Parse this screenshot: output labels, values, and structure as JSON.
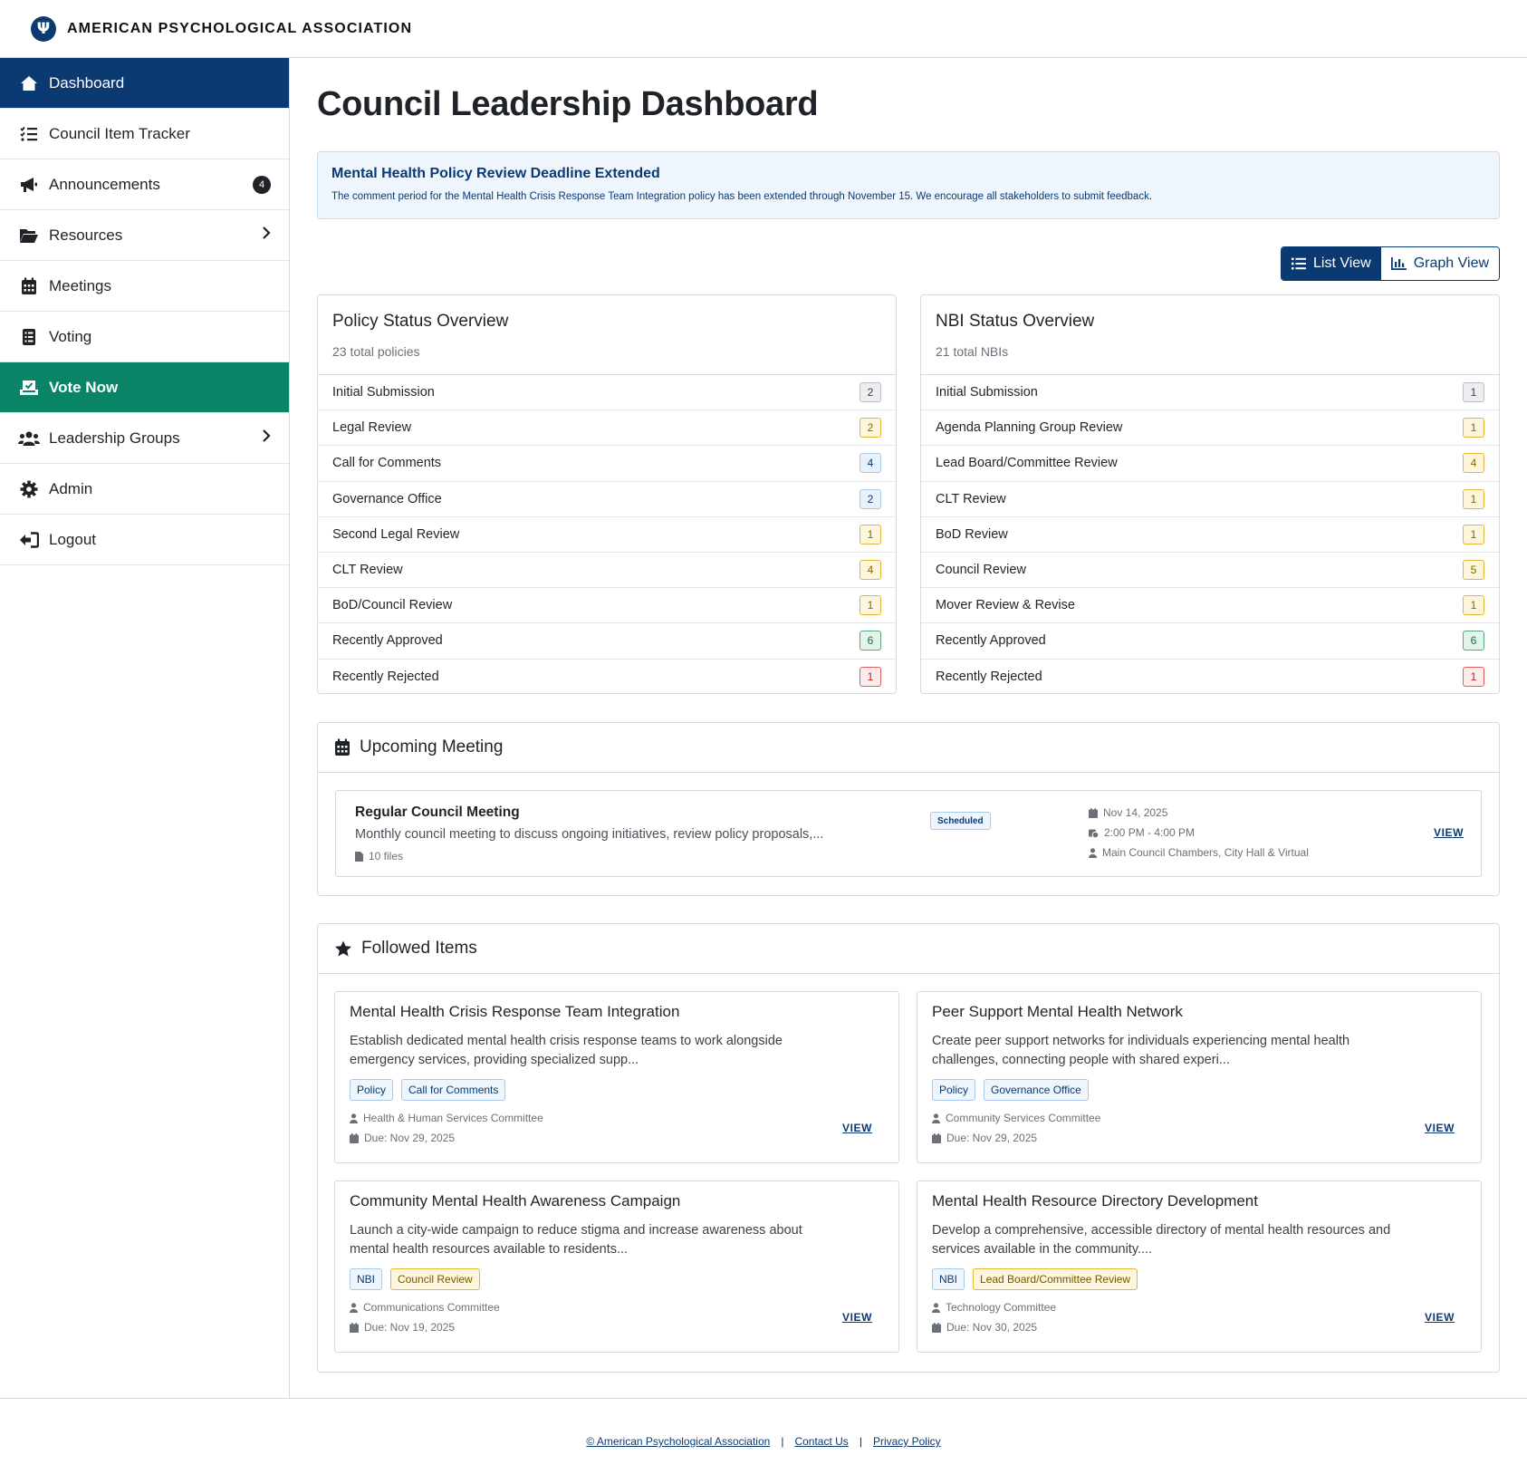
{
  "header": {
    "org_name": "AMERICAN PSYCHOLOGICAL ASSOCIATION",
    "logo_glyph": "Ψ"
  },
  "sidebar": {
    "items": [
      {
        "label": "Dashboard",
        "icon": "home-icon"
      },
      {
        "label": "Council Item Tracker",
        "icon": "list-check-icon"
      },
      {
        "label": "Announcements",
        "icon": "megaphone-icon",
        "badge": "4"
      },
      {
        "label": "Resources",
        "icon": "folder-open-icon",
        "chevron": "›"
      },
      {
        "label": "Meetings",
        "icon": "calendar-icon"
      },
      {
        "label": "Voting",
        "icon": "ballot-icon"
      },
      {
        "label": "Vote Now",
        "icon": "vote-box-icon"
      },
      {
        "label": "Leadership Groups",
        "icon": "users-icon",
        "chevron": "›"
      },
      {
        "label": "Admin",
        "icon": "gear-icon"
      },
      {
        "label": "Logout",
        "icon": "logout-icon"
      }
    ]
  },
  "page": {
    "title": "Council Leadership Dashboard"
  },
  "alert": {
    "title": "Mental Health Policy Review Deadline Extended",
    "body": "The comment period for the Mental Health Crisis Response Team Integration policy has been extended through November 15. We encourage all stakeholders to submit feedback."
  },
  "view_toggle": {
    "list_label": "List View",
    "graph_label": "Graph View"
  },
  "policy_panel": {
    "title": "Policy Status Overview",
    "subtitle": "23 total policies",
    "rows": [
      {
        "label": "Initial Submission",
        "count": "2",
        "color": "gray"
      },
      {
        "label": "Legal Review",
        "count": "2",
        "color": "yellow"
      },
      {
        "label": "Call for Comments",
        "count": "4",
        "color": "blue"
      },
      {
        "label": "Governance Office",
        "count": "2",
        "color": "blue"
      },
      {
        "label": "Second Legal Review",
        "count": "1",
        "color": "yellow"
      },
      {
        "label": "CLT Review",
        "count": "4",
        "color": "yellow"
      },
      {
        "label": "BoD/Council Review",
        "count": "1",
        "color": "yellow"
      },
      {
        "label": "Recently Approved",
        "count": "6",
        "color": "green"
      },
      {
        "label": "Recently Rejected",
        "count": "1",
        "color": "red"
      }
    ]
  },
  "nbi_panel": {
    "title": "NBI Status Overview",
    "subtitle": "21 total NBIs",
    "rows": [
      {
        "label": "Initial Submission",
        "count": "1",
        "color": "gray"
      },
      {
        "label": "Agenda Planning Group Review",
        "count": "1",
        "color": "yellow"
      },
      {
        "label": "Lead Board/Committee Review",
        "count": "4",
        "color": "yellow"
      },
      {
        "label": "CLT Review",
        "count": "1",
        "color": "yellow"
      },
      {
        "label": "BoD Review",
        "count": "1",
        "color": "yellow"
      },
      {
        "label": "Council Review",
        "count": "5",
        "color": "yellow"
      },
      {
        "label": "Mover Review & Revise",
        "count": "1",
        "color": "yellow"
      },
      {
        "label": "Recently Approved",
        "count": "6",
        "color": "green"
      },
      {
        "label": "Recently Rejected",
        "count": "1",
        "color": "red"
      }
    ]
  },
  "upcoming_meeting": {
    "heading": "Upcoming Meeting",
    "title": "Regular Council Meeting",
    "description": "Monthly council meeting to discuss ongoing initiatives, review policy proposals,...",
    "files": "10 files",
    "status": "Scheduled",
    "date": "Nov 14, 2025",
    "time": "2:00 PM - 4:00 PM",
    "location": "Main Council Chambers, City Hall & Virtual",
    "view_label": "VIEW"
  },
  "followed": {
    "heading": "Followed Items",
    "items": [
      {
        "title": "Mental Health Crisis Response Team Integration",
        "description": "Establish dedicated mental health crisis response teams to work alongside emergency services, providing specialized supp...",
        "type_tag": "Policy",
        "status_tag": "Call for Comments",
        "status_color": "blue",
        "committee": "Health & Human Services Committee",
        "due": "Due: Nov 29, 2025",
        "view_label": "VIEW"
      },
      {
        "title": "Peer Support Mental Health Network",
        "description": "Create peer support networks for individuals experiencing mental health challenges, connecting people with shared experi...",
        "type_tag": "Policy",
        "status_tag": "Governance Office",
        "status_color": "blue",
        "committee": "Community Services Committee",
        "due": "Due: Nov 29, 2025",
        "view_label": "VIEW"
      },
      {
        "title": "Community Mental Health Awareness Campaign",
        "description": "Launch a city-wide campaign to reduce stigma and increase awareness about mental health resources available to residents...",
        "type_tag": "NBI",
        "status_tag": "Council Review",
        "status_color": "yellow",
        "committee": "Communications Committee",
        "due": "Due: Nov 19, 2025",
        "view_label": "VIEW"
      },
      {
        "title": "Mental Health Resource Directory Development",
        "description": "Develop a comprehensive, accessible directory of mental health resources and services available in the community....",
        "type_tag": "NBI",
        "status_tag": "Lead Board/Committee Review",
        "status_color": "yellow",
        "committee": "Technology Committee",
        "due": "Due: Nov 30, 2025",
        "view_label": "VIEW"
      }
    ]
  },
  "footer": {
    "copyright": "© American Psychological Association",
    "separator": "|",
    "contact": "Contact Us",
    "privacy": "Privacy Policy"
  }
}
